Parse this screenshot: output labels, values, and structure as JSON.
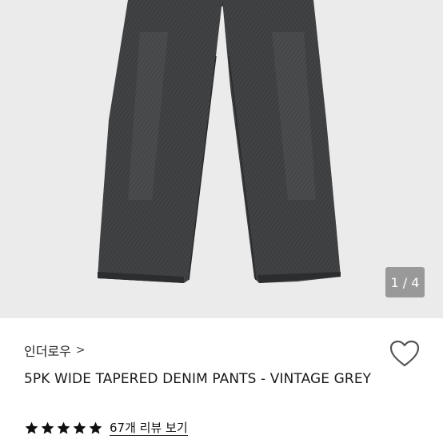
{
  "gallery": {
    "counter": "1 / 4",
    "background_color": "#ebebec",
    "product_color": "#3b3c3e"
  },
  "product": {
    "brand": "인더로우",
    "brand_chevron": ">",
    "title": "5PK WIDE TAPERED DENIM PANTS - VINTAGE GREY",
    "rating_stars": 5,
    "review_link": "67개 리뷰 보기",
    "wishlist_icon": "heart-outline-icon",
    "star_icon": "star-filled-icon"
  }
}
